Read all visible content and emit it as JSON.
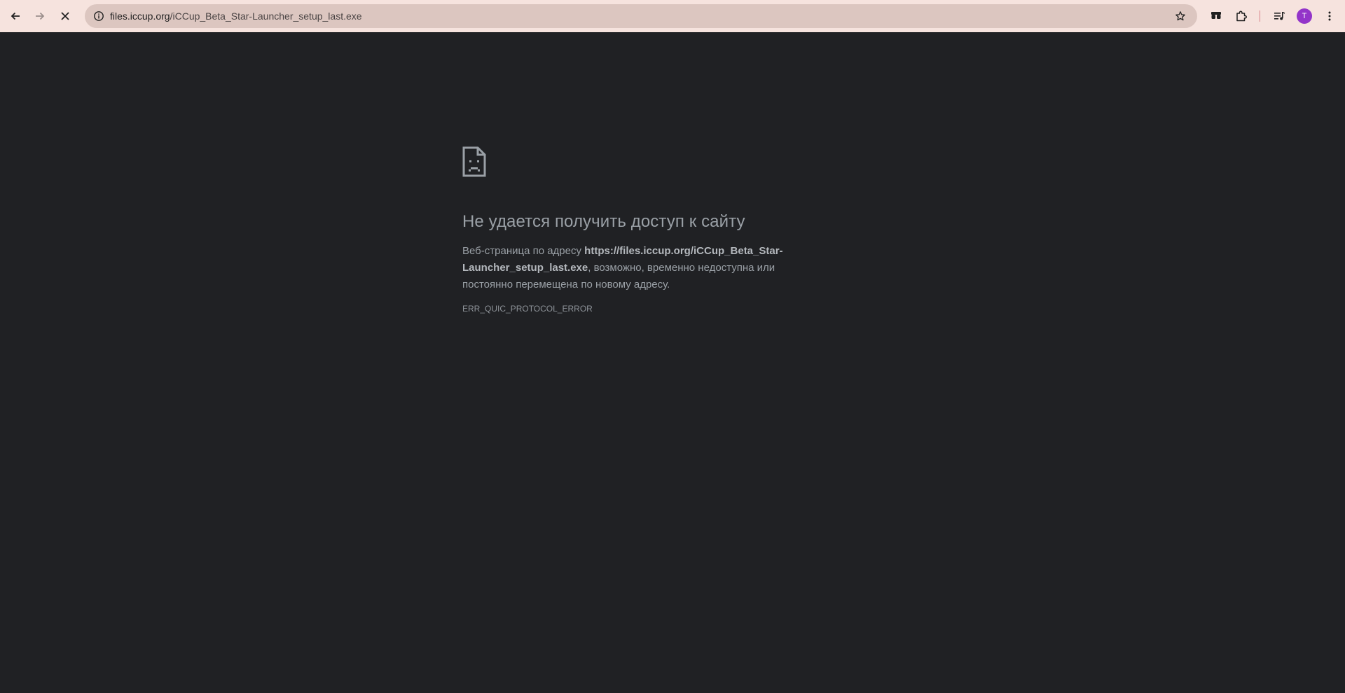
{
  "browser": {
    "address_bar": {
      "domain": "files.iccup.org",
      "path": "/iCCup_Beta_Star-Launcher_setup_last.exe"
    },
    "profile_initial": "T",
    "colors": {
      "toolbar": "#f6e3de",
      "omnibox": "#dcc6c0",
      "avatar": "#9334c9",
      "page_background": "#202124"
    },
    "icons": {
      "back": "arrow-left",
      "forward": "arrow-right",
      "stop": "close",
      "site_info": "info-circle",
      "bookmark": "star-outline",
      "extension_pinned": "sunglasses",
      "extensions": "puzzle",
      "media": "playlist-music",
      "menu": "kebab-vertical"
    }
  },
  "error_page": {
    "icon": "sad-document",
    "title": "Не удается получить доступ к сайту",
    "description_prefix": "Веб-страница по адресу ",
    "url_line1": "https://files.iccup.org/iCCup_Beta_Star-",
    "url_line2": "Launcher_setup_last.exe",
    "description_suffix": ", возможно, временно недоступна или постоянно перемещена по новому адресу.",
    "error_code": "ERR_QUIC_PROTOCOL_ERROR"
  }
}
